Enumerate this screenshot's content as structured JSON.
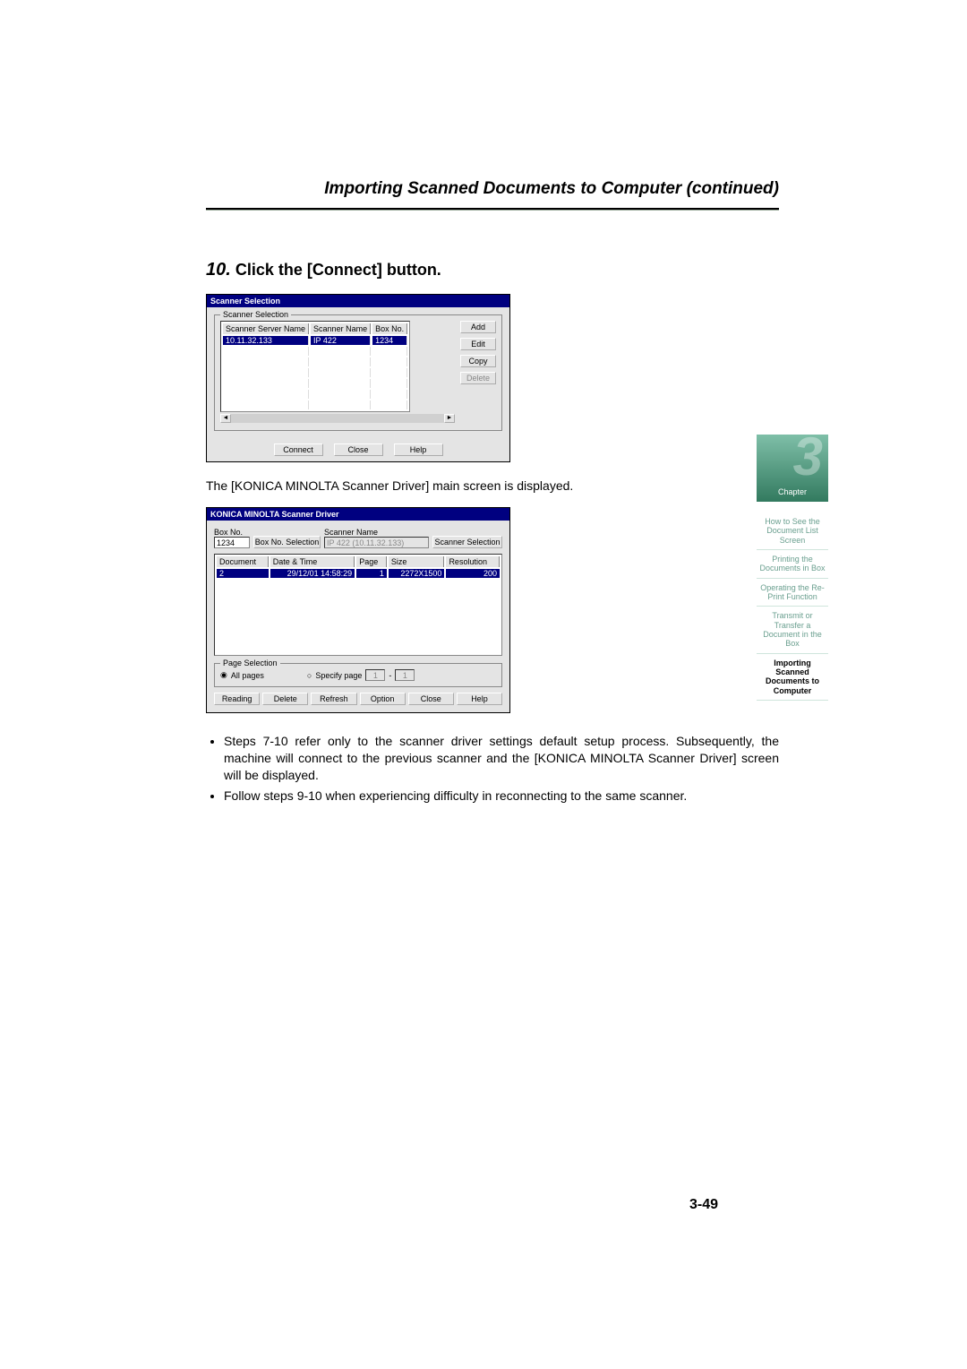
{
  "header_title": "Importing Scanned Documents to Computer (continued)",
  "step": {
    "num": "10.",
    "text": "Click the [Connect] button."
  },
  "dialog1": {
    "title": "Scanner Selection",
    "group": "Scanner Selection",
    "cols": {
      "c1": "Scanner Server Name",
      "c2": "Scanner Name",
      "c3": "Box No."
    },
    "row": {
      "server": "10.11.32.133",
      "name": "IP 422",
      "box": "1234"
    },
    "btns": {
      "add": "Add",
      "edit": "Edit",
      "copy": "Copy",
      "del": "Delete"
    },
    "bottom": {
      "connect": "Connect",
      "close": "Close",
      "help": "Help"
    },
    "scroll": {
      "left": "◄",
      "right": "►"
    }
  },
  "between": "The [KONICA MINOLTA Scanner Driver] main screen is displayed.",
  "dialog2": {
    "title": "KONICA MINOLTA Scanner Driver",
    "labels": {
      "boxno": "Box No.",
      "scannername": "Scanner Name"
    },
    "fields": {
      "boxno": "1234",
      "scannername": "IP 422 (10.11.32.133)"
    },
    "btns": {
      "boxsel": "Box No. Selection",
      "scansel": "Scanner Selection"
    },
    "doccols": {
      "doc": "Document",
      "dt": "Date & Time",
      "page": "Page",
      "size": "Size",
      "res": "Resolution"
    },
    "docrow": {
      "doc": "2",
      "dt": "29/12/01 14:58:29",
      "page": "1",
      "size": "2272X1500",
      "res": "200"
    },
    "pagesel": {
      "label": "Page Selection",
      "all": "All pages",
      "spec": "Specify page",
      "from": "1",
      "to": "1",
      "dash": "-"
    },
    "bottom": {
      "reading": "Reading",
      "delete": "Delete",
      "refresh": "Refresh",
      "option": "Option",
      "close": "Close",
      "help": "Help"
    }
  },
  "bullets": {
    "b1": "Steps 7-10 refer only to the scanner driver settings default setup process. Subsequently, the machine will connect to the previous scanner and the [KONICA MINOLTA Scanner Driver] screen will be displayed.",
    "b2": "Follow steps 9-10 when experiencing difficulty in reconnecting to the same scanner."
  },
  "page_num": "3-49",
  "sidetab": {
    "chapter_label": "Chapter",
    "chapter_num": "3",
    "nav1": "How to See the Document List Screen",
    "nav2": "Printing the Documents in Box",
    "nav3": "Operating the Re-Print Function",
    "nav4": "Transmit or Transfer a Document in the Box",
    "nav5": "Importing Scanned Documents to Computer"
  }
}
